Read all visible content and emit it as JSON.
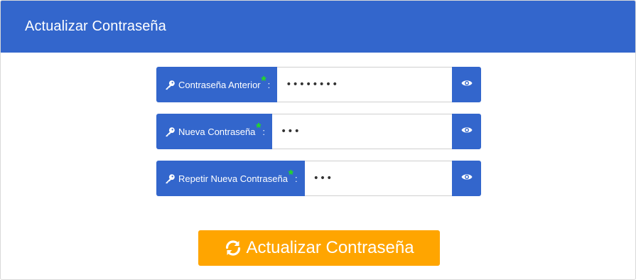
{
  "header": {
    "title": "Actualizar Contraseña"
  },
  "fields": [
    {
      "label": "Contraseña Anterior",
      "required_mark": "*",
      "colon": ":",
      "value": "••••••••",
      "icon": "key-icon",
      "toggle_icon": "eye-icon"
    },
    {
      "label": "Nueva Contraseña",
      "required_mark": "*",
      "colon": ":",
      "value": "•••",
      "icon": "key-icon",
      "toggle_icon": "eye-icon"
    },
    {
      "label": "Repetir Nueva Contraseña",
      "required_mark": "*",
      "colon": ":",
      "value": "•••",
      "icon": "key-icon",
      "toggle_icon": "eye-icon"
    }
  ],
  "submit": {
    "label": "Actualizar Contraseña",
    "icon": "refresh-icon"
  },
  "colors": {
    "primary": "#3366cc",
    "accent": "#ffa500",
    "required": "#22dd22"
  }
}
